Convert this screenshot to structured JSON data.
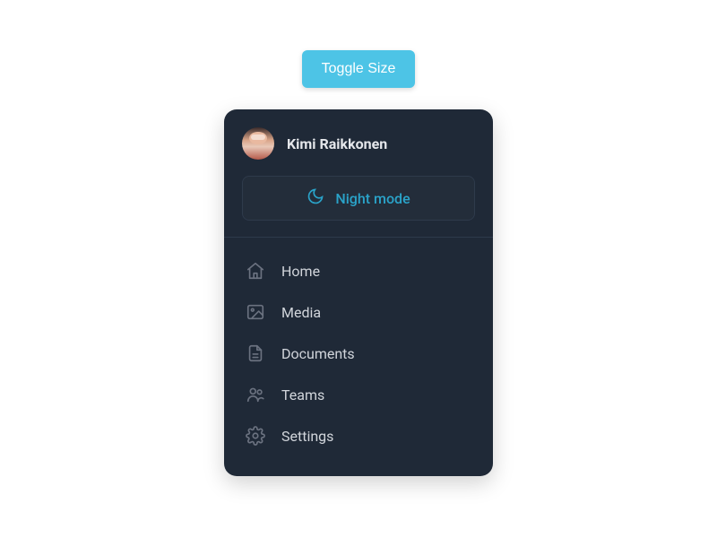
{
  "toggle_button_label": "Toggle Size",
  "user": {
    "name": "Kimi Raikkonen"
  },
  "night_mode": {
    "label": "Night mode"
  },
  "menu": {
    "items": [
      {
        "label": "Home",
        "icon": "home-icon"
      },
      {
        "label": "Media",
        "icon": "image-icon"
      },
      {
        "label": "Documents",
        "icon": "document-icon"
      },
      {
        "label": "Teams",
        "icon": "users-icon"
      },
      {
        "label": "Settings",
        "icon": "gear-icon"
      }
    ]
  },
  "colors": {
    "card_bg": "#1f2937",
    "accent": "#2aa3c9",
    "toggle_bg": "#4dc4e6"
  }
}
